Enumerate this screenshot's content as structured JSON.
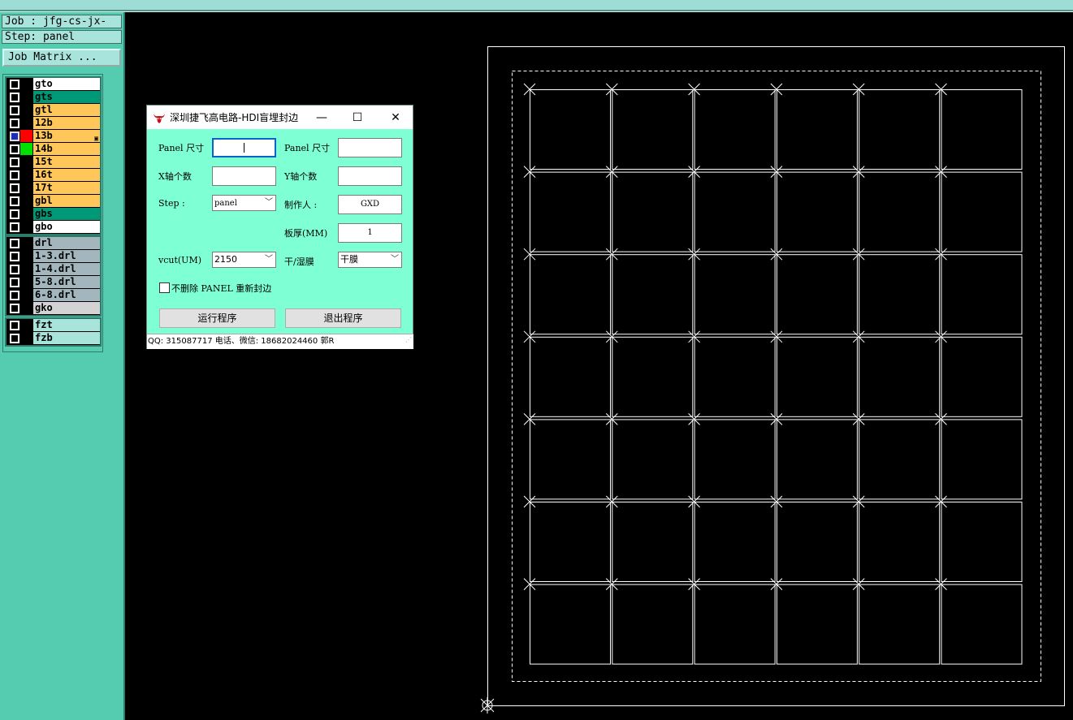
{
  "window": {
    "job_label": "Job : jfg-cs-jx-",
    "step_label": "Step: panel",
    "job_matrix_button": "Job Matrix ..."
  },
  "layers": {
    "group1": [
      {
        "name": "gto",
        "color": "#ffffff",
        "swatch": "#000000",
        "active": false
      },
      {
        "name": "gts",
        "color": "#009977",
        "swatch": "#000000",
        "active": false
      },
      {
        "name": "gtl",
        "color": "#ffc75a",
        "swatch": "#000000",
        "active": false
      },
      {
        "name": "12b",
        "color": "#ffc75a",
        "swatch": "#000000",
        "active": false
      },
      {
        "name": "13b",
        "color": "#ffc75a",
        "swatch": "#ff0000",
        "active": true,
        "mark": "▣"
      },
      {
        "name": "14b",
        "color": "#ffc75a",
        "swatch": "#00e000",
        "active": false
      },
      {
        "name": "15t",
        "color": "#ffc75a",
        "swatch": "#000000",
        "active": false
      },
      {
        "name": "16t",
        "color": "#ffc75a",
        "swatch": "#000000",
        "active": false
      },
      {
        "name": "17t",
        "color": "#ffc75a",
        "swatch": "#000000",
        "active": false
      },
      {
        "name": "gbl",
        "color": "#ffc75a",
        "swatch": "#000000",
        "active": false
      },
      {
        "name": "gbs",
        "color": "#009977",
        "swatch": "#000000",
        "active": false
      },
      {
        "name": "gbo",
        "color": "#ffffff",
        "swatch": "#000000",
        "active": false
      }
    ],
    "group2": [
      {
        "name": "drl",
        "color": "#a3b5bd",
        "swatch": "#000000",
        "active": false
      },
      {
        "name": "1-3.drl",
        "color": "#a3b5bd",
        "swatch": "#000000",
        "active": false
      },
      {
        "name": "1-4.drl",
        "color": "#a3b5bd",
        "swatch": "#000000",
        "active": false
      },
      {
        "name": "5-8.drl",
        "color": "#a3b5bd",
        "swatch": "#000000",
        "active": false
      },
      {
        "name": "6-8.drl",
        "color": "#a3b5bd",
        "swatch": "#000000",
        "active": false
      },
      {
        "name": "gko",
        "color": "#d3d3d3",
        "swatch": "#000000",
        "active": false
      }
    ],
    "group3": [
      {
        "name": "fzt",
        "color": "#a8e3dc",
        "swatch": "#000000",
        "active": false
      },
      {
        "name": "fzb",
        "color": "#a8e3dc",
        "swatch": "#000000",
        "active": false
      }
    ]
  },
  "dialog": {
    "title": "深圳捷飞高电路-HDI盲埋封边",
    "minimize": "—",
    "maximize": "☐",
    "close": "✕",
    "panel_size_label_1": "Panel 尺寸",
    "panel_size_label_2": "Panel 尺寸",
    "panel_size_value_1": "",
    "panel_size_value_2": "",
    "x_count_label": "X轴个数",
    "y_count_label": "Y轴个数",
    "x_count_value": "",
    "y_count_value": "",
    "step_label": "Step   :",
    "step_value": "panel",
    "maker_label": "制作人  :",
    "maker_value": "GXD",
    "thickness_label": "板厚(MM)",
    "thickness_value": "1",
    "vcut_label": "vcut(UM)",
    "vcut_value": "2150",
    "film_label": "干/湿膜",
    "film_value": "干膜",
    "keep_panel_checkbox_label": "不删除 PANEL 重新封边",
    "keep_panel_checked": false,
    "run_button": "运行程序",
    "exit_button": "退出程序",
    "status": "QQ: 315087717  电话、微信: 18682024460  郭R",
    "dropdown_arrow": "﹀"
  },
  "board": {
    "columns": 6,
    "rows": 7,
    "line_color": "#ffffff"
  }
}
